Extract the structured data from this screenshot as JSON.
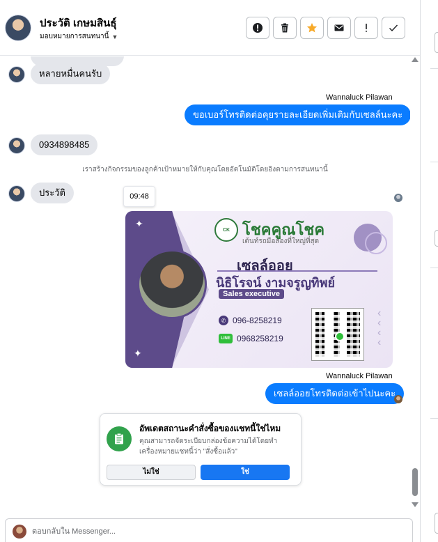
{
  "header": {
    "contact_name": "ประวัติ เกษมสินธุ์",
    "assign_label": "มอบหมายการสนทนานี้",
    "toolbar": [
      {
        "name": "spam-button",
        "icon": "alert-circle-icon"
      },
      {
        "name": "delete-button",
        "icon": "trash-icon"
      },
      {
        "name": "star-button",
        "icon": "star-icon"
      },
      {
        "name": "mark-unread-button",
        "icon": "envelope-icon"
      },
      {
        "name": "follow-up-button",
        "icon": "exclamation-icon"
      },
      {
        "name": "done-button",
        "icon": "check-icon"
      }
    ]
  },
  "messages": {
    "in_1": "หลายหมื่นคนรับ",
    "sender_1": "Wannaluck Pilawan",
    "out_1": "ขอเบอร์โทรติดต่อคุยรายละเอียดเพิ่มเติมกับเซลล์นะคะ",
    "in_2": "0934898485",
    "system_note": "เราสร้างกิจกรรมของลูกค้าเป้าหมายให้กับคุณโดยอัตโนมัติโดยอิงตามการสนทนานี้",
    "in_3": "ประวัติ",
    "time_tooltip": "09:48",
    "sender_2": "Wannaluck Pilawan",
    "out_2": "เซลล์ออยโทรติดต่อเข้าไปนะคะ"
  },
  "business_card": {
    "brand_name": "โชคคูณโชค",
    "brand_tagline": "เต้นท์รถมือสองที่ใหญ่ที่สุด",
    "logo_text": "CK",
    "nickname": "เซลล์ออย",
    "full_name": "นิธิโรจน์  งามจรูญทิพย์",
    "role": "Sales executive",
    "phone": "096-8258219",
    "line_label": "LINE",
    "line_id": "0968258219"
  },
  "order_card": {
    "title": "อัพเดตสถานะคำสั่งซื้อของแชทนี้ใช่ไหม",
    "body": "คุณสามารถจัดระเบียบกล่องข้อความได้โดยทำเครื่องหมายแชทนี้ว่า \"สั่งซื้อแล้ว\"",
    "no_label": "ไม่ใช่",
    "yes_label": "ใช่"
  },
  "reply": {
    "placeholder": "ตอบกลับใน Messenger..."
  },
  "colors": {
    "accent": "#0a7cff",
    "primary_button": "#1877f2",
    "star": "#f7a928",
    "success": "#31a24c"
  }
}
